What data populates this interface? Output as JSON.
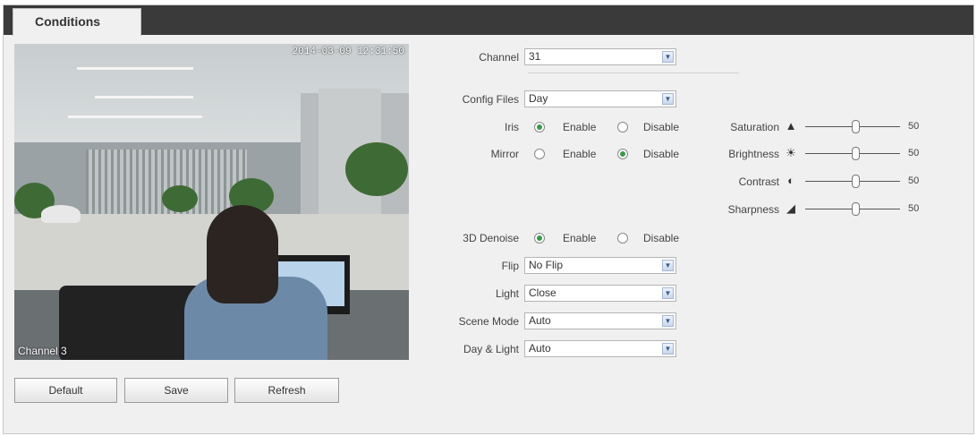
{
  "tab": {
    "label": "Conditions"
  },
  "preview": {
    "timestamp": "2014-03-09 12:31:50",
    "channel_label": "Channel 3"
  },
  "form": {
    "channel": {
      "label": "Channel",
      "value": "31"
    },
    "config_files": {
      "label": "Config Files",
      "value": "Day"
    },
    "iris": {
      "label": "Iris",
      "enable": "Enable",
      "disable": "Disable",
      "selected": "Enable"
    },
    "mirror": {
      "label": "Mirror",
      "enable": "Enable",
      "disable": "Disable",
      "selected": "Disable"
    },
    "denoise": {
      "label": "3D Denoise",
      "enable": "Enable",
      "disable": "Disable",
      "selected": "Enable"
    },
    "flip": {
      "label": "Flip",
      "value": "No Flip"
    },
    "light": {
      "label": "Light",
      "value": "Close"
    },
    "scene_mode": {
      "label": "Scene Mode",
      "value": "Auto"
    },
    "day_light": {
      "label": "Day & Light",
      "value": "Auto"
    }
  },
  "sliders": [
    {
      "label": "Saturation",
      "value": "50",
      "icon": "saturation-icon"
    },
    {
      "label": "Brightness",
      "value": "50",
      "icon": "brightness-icon"
    },
    {
      "label": "Contrast",
      "value": "50",
      "icon": "contrast-icon"
    },
    {
      "label": "Sharpness",
      "value": "50",
      "icon": "sharpness-icon"
    }
  ],
  "buttons": {
    "default": "Default",
    "save": "Save",
    "refresh": "Refresh"
  }
}
